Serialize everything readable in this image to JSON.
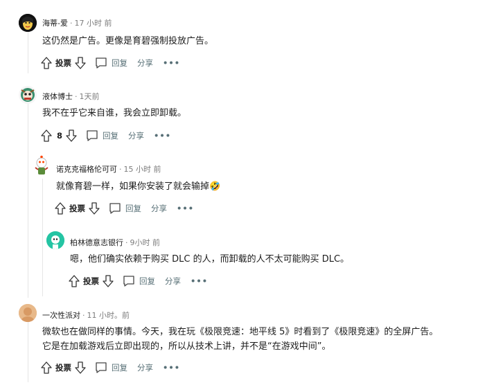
{
  "comments": [
    {
      "username": "海蒂-爱",
      "time": "17 小时 前",
      "lines": [
        "这仍然是广告。更像是育碧强制投放广告。"
      ],
      "vote_label": "投票",
      "reply_label": "回复",
      "share_label": "分享"
    },
    {
      "username": "液体博士",
      "time": "1天前",
      "lines": [
        "我不在乎它来自谁，我会立即卸载。"
      ],
      "vote_count": "8",
      "reply_label": "回复",
      "share_label": "分享"
    },
    {
      "username": "诺克克福格伦可可",
      "time": "15 小时 前",
      "lines": [
        "就像育碧一样，如果你安装了就会输掉"
      ],
      "emoji": "🤣",
      "vote_label": "投票",
      "reply_label": "回复",
      "share_label": "分享"
    },
    {
      "username": "柏林德意志银行",
      "time": "9小时 前",
      "lines": [
        "嗯，他们确实依赖于购买 DLC 的人，而卸载的人不太可能购买 DLC。"
      ],
      "vote_label": "投票",
      "reply_label": "回复",
      "share_label": "分享"
    },
    {
      "username": "一次性派对",
      "time": "11 小时。前",
      "lines": [
        "微软也在做同样的事情。今天，我在玩《极限竞速：地平线 5》时看到了《极限竞速》的全屏广告。",
        "它是在加载游戏后立即出现的，所以从技术上讲，并不是“在游戏中间”。"
      ],
      "vote_label": "投票",
      "reply_label": "回复",
      "share_label": "分享"
    }
  ],
  "more_label": "•••"
}
